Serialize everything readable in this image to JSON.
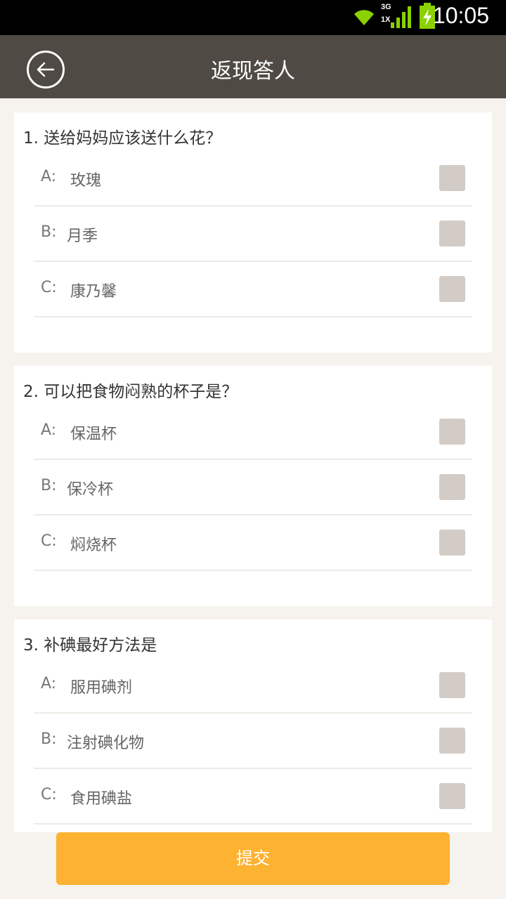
{
  "status_bar": {
    "time": "10:05",
    "network_label_top": "3G",
    "network_label_bottom": "1X",
    "icons": [
      "wifi-icon",
      "signal-icon",
      "battery-charging-icon"
    ]
  },
  "header": {
    "title": "返现答人",
    "back_icon": "back-arrow-icon"
  },
  "questions": [
    {
      "title": "1. 送给妈妈应该送什么花？",
      "options": [
        {
          "letter": "A:",
          "text": "玫瑰",
          "checked": false
        },
        {
          "letter": "B:",
          "text": "月季",
          "checked": false
        },
        {
          "letter": "C:",
          "text": "康乃馨",
          "checked": false
        }
      ]
    },
    {
      "title": "2. 可以把食物闷熟的杯子是？",
      "options": [
        {
          "letter": "A:",
          "text": "保温杯",
          "checked": false
        },
        {
          "letter": "B:",
          "text": "保冷杯",
          "checked": false
        },
        {
          "letter": "C:",
          "text": "焖烧杯",
          "checked": false
        }
      ]
    },
    {
      "title": "3. 补碘最好方法是",
      "options": [
        {
          "letter": "A:",
          "text": "服用碘剂",
          "checked": false
        },
        {
          "letter": "B:",
          "text": "注射碘化物",
          "checked": false
        },
        {
          "letter": "C:",
          "text": "食用碘盐",
          "checked": false
        }
      ]
    }
  ],
  "submit": {
    "label": "提交"
  },
  "colors": {
    "header_bg": "#4f4a44",
    "page_bg": "#f6f2ee",
    "checkbox": "#d3ccc6",
    "submit_bg": "#fdb231"
  }
}
